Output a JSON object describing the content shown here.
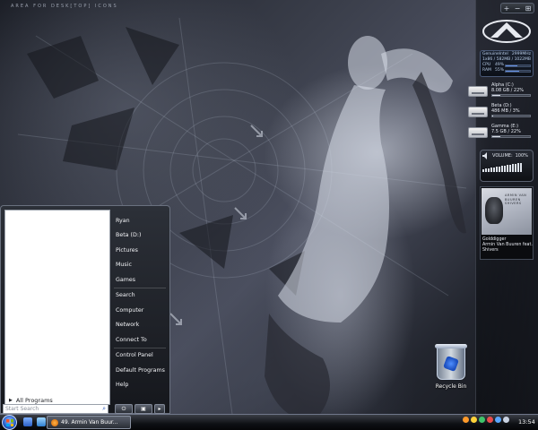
{
  "wallpaper": {
    "caption": "AREA FOR DESK[TOP] ICONS"
  },
  "sidebar": {
    "controls": [
      "+",
      "−",
      "⊞"
    ],
    "cpu": {
      "line1_left": "GenuineIntel",
      "line1_right": "2999MHz",
      "line2": "1x86 / 582MB / 1022MB",
      "meters": [
        {
          "label": "CPU",
          "value": "49%",
          "fraction": 0.49
        },
        {
          "label": "RAM",
          "value": "55%",
          "fraction": 0.55
        }
      ]
    },
    "drives": [
      {
        "name": "Alpha (C:)",
        "detail": "8.08 GB / 22%",
        "fraction": 0.22
      },
      {
        "name": "Beta (D:)",
        "detail": "486 MB / 3%",
        "fraction": 0.03
      },
      {
        "name": "Gamma (E:)",
        "detail": "7.5 GB / 22%",
        "fraction": 0.22
      }
    ],
    "volume": {
      "label": "VOLUME:",
      "value": "100%"
    },
    "media": {
      "art_text": "ARMIN VAN BUUREN SHIVERS",
      "title": "Golddigger",
      "artist": "Armin Van Buuren feat.",
      "extra": "Shivers"
    }
  },
  "desktop": {
    "recycle_bin": "Recycle Bin"
  },
  "start_menu": {
    "all_programs": "All Programs",
    "search_placeholder": "Start Search",
    "items": [
      "Ryan",
      "Beta (D:)",
      "Pictures",
      "Music",
      "Games",
      "Search",
      "Computer",
      "Network",
      "Connect To",
      "Control Panel",
      "Default Programs",
      "Help"
    ]
  },
  "taskbar": {
    "task_label": "49. Armin Van Buur...",
    "clock": "13:54"
  },
  "colors": {
    "accent": "#235ac4",
    "menu_bg": "#15171c"
  }
}
